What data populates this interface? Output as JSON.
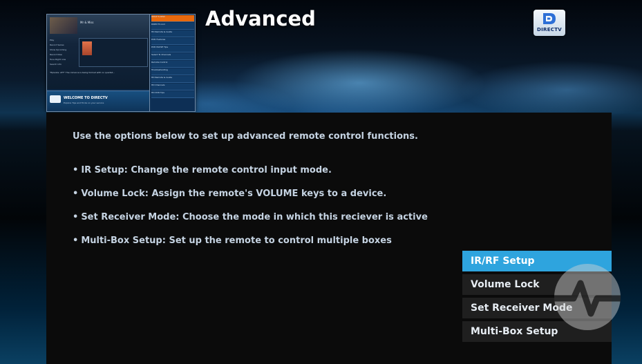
{
  "header": {
    "title": "Advanced",
    "logo_text": "DIRECTV"
  },
  "preview": {
    "program_title": "Mr & Miss",
    "left_menu": [
      "Play",
      "Record Series",
      "Show Upcoming",
      "Record Now",
      "Tune Right now",
      "Search Info"
    ],
    "description": "\"Episode: ATT\" The romance is being formed with no quartet...",
    "welcome_title": "WELCOME TO DIRECTV",
    "welcome_sub": "Explore Tips and Tricks on your service",
    "side_menu": [
      "WHAT'S NEW",
      "DIRECTV.com",
      "HD Remote & Guide",
      "DVR Features",
      "DVR PAUSE Tips",
      "Select To Channels",
      "Remote Control",
      "Troubleshooting",
      "HD Remote & Guide",
      "HD Channels",
      "HD DVR Tips"
    ]
  },
  "content": {
    "intro": "Use the options below to set up advanced remote control functions.",
    "bullets": [
      "IR Setup: Change the remote control input mode.",
      "Volume Lock: Assign the remote's VOLUME keys to a device.",
      "Set Receiver Mode: Choose the mode in which this reciever is active",
      "Multi-Box Setup: Set up the remote to control multiple boxes"
    ],
    "bullet_glyph": "•"
  },
  "menu": {
    "items": [
      "IR/RF Setup",
      "Volume Lock",
      "Set Receiver Mode",
      "Multi-Box Setup"
    ],
    "selected": "IR/RF Setup"
  },
  "colors": {
    "accent": "#2ea4de",
    "menu_bg": "#1f1f1f",
    "text": "#c5d3e2",
    "preview_active": "#e8690d"
  },
  "icons": {
    "logo": "directv-logo-icon",
    "watermark": "watermark-icon"
  }
}
